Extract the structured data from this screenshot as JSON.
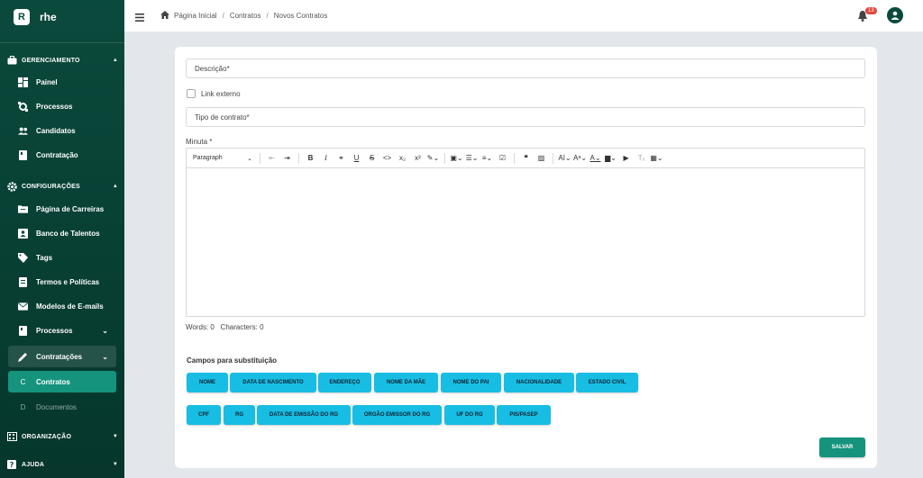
{
  "brand": {
    "logo_letter": "R",
    "name": "rhe"
  },
  "sidebar": {
    "sections": [
      {
        "label": "GERENCIAMENTO",
        "icon": "briefcase-icon"
      },
      {
        "label": "CONFIGURAÇÕES",
        "icon": "gear-icon"
      },
      {
        "label": "ORGANIZAÇÃO",
        "icon": "building-icon"
      },
      {
        "label": "AJUDA",
        "icon": "help-icon"
      }
    ],
    "items": {
      "painel": "Painel",
      "processos": "Processos",
      "candidatos": "Candidatos",
      "contratacao": "Contratação",
      "carreiras": "Página de Carreiras",
      "talentos": "Banco de Talentos",
      "tags": "Tags",
      "termos": "Termos e Políticas",
      "emails": "Modelos de E-mails",
      "processos2": "Processos",
      "contratacoes": "Contratações",
      "contratos": "Contratos",
      "documentos": "Documentos"
    },
    "sub_letters": {
      "contratos": "C",
      "documentos": "D"
    },
    "colors": {
      "bg": "#0a4a3c",
      "active": "#15937d"
    }
  },
  "breadcrumb": {
    "home": "Página Inicial",
    "section": "Contratos",
    "current": "Novos Contratos"
  },
  "notifications": {
    "count": "13"
  },
  "form": {
    "descricao_placeholder": "Descrição*",
    "link_externo": "Link externo",
    "tipo_placeholder": "Tipo de contrato*",
    "minuta_label": "Minuta *",
    "paragraph_select": "Paragraph",
    "word_count": "Words: 0",
    "char_count": "Characters: 0",
    "substitution_title": "Campos para substituição",
    "chips_row1": [
      "NOME",
      "DATA DE NASCIMENTO",
      "ENDEREÇO",
      "NOME DA MÃE",
      "NOME DO PAI",
      "NACIONALIDADE",
      "ESTADO CIVIL"
    ],
    "chips_row2": [
      "CPF",
      "RG",
      "DATA DE EMISSÃO DO RG",
      "ORGÃO EMISSOR DO RG",
      "UF DO RG",
      "PIS/PASEP"
    ],
    "save_label": "SALVAR",
    "colors": {
      "chip": "#17bde3",
      "save": "#15937d"
    }
  }
}
